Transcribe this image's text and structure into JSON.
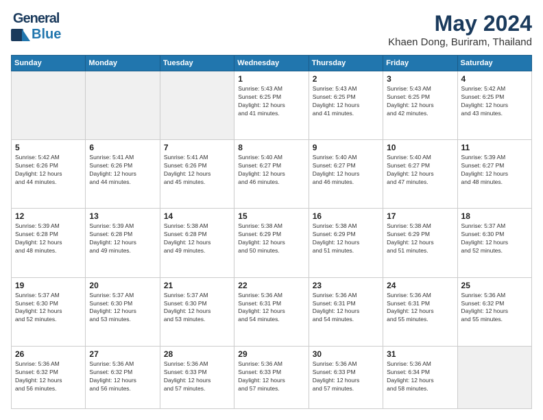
{
  "header": {
    "logo_line1": "General",
    "logo_line2": "Blue",
    "title": "May 2024",
    "subtitle": "Khaen Dong, Buriram, Thailand"
  },
  "weekdays": [
    "Sunday",
    "Monday",
    "Tuesday",
    "Wednesday",
    "Thursday",
    "Friday",
    "Saturday"
  ],
  "weeks": [
    [
      {
        "day": "",
        "info": ""
      },
      {
        "day": "",
        "info": ""
      },
      {
        "day": "",
        "info": ""
      },
      {
        "day": "1",
        "info": "Sunrise: 5:43 AM\nSunset: 6:25 PM\nDaylight: 12 hours\nand 41 minutes."
      },
      {
        "day": "2",
        "info": "Sunrise: 5:43 AM\nSunset: 6:25 PM\nDaylight: 12 hours\nand 41 minutes."
      },
      {
        "day": "3",
        "info": "Sunrise: 5:43 AM\nSunset: 6:25 PM\nDaylight: 12 hours\nand 42 minutes."
      },
      {
        "day": "4",
        "info": "Sunrise: 5:42 AM\nSunset: 6:25 PM\nDaylight: 12 hours\nand 43 minutes."
      }
    ],
    [
      {
        "day": "5",
        "info": "Sunrise: 5:42 AM\nSunset: 6:26 PM\nDaylight: 12 hours\nand 44 minutes."
      },
      {
        "day": "6",
        "info": "Sunrise: 5:41 AM\nSunset: 6:26 PM\nDaylight: 12 hours\nand 44 minutes."
      },
      {
        "day": "7",
        "info": "Sunrise: 5:41 AM\nSunset: 6:26 PM\nDaylight: 12 hours\nand 45 minutes."
      },
      {
        "day": "8",
        "info": "Sunrise: 5:40 AM\nSunset: 6:27 PM\nDaylight: 12 hours\nand 46 minutes."
      },
      {
        "day": "9",
        "info": "Sunrise: 5:40 AM\nSunset: 6:27 PM\nDaylight: 12 hours\nand 46 minutes."
      },
      {
        "day": "10",
        "info": "Sunrise: 5:40 AM\nSunset: 6:27 PM\nDaylight: 12 hours\nand 47 minutes."
      },
      {
        "day": "11",
        "info": "Sunrise: 5:39 AM\nSunset: 6:27 PM\nDaylight: 12 hours\nand 48 minutes."
      }
    ],
    [
      {
        "day": "12",
        "info": "Sunrise: 5:39 AM\nSunset: 6:28 PM\nDaylight: 12 hours\nand 48 minutes."
      },
      {
        "day": "13",
        "info": "Sunrise: 5:39 AM\nSunset: 6:28 PM\nDaylight: 12 hours\nand 49 minutes."
      },
      {
        "day": "14",
        "info": "Sunrise: 5:38 AM\nSunset: 6:28 PM\nDaylight: 12 hours\nand 49 minutes."
      },
      {
        "day": "15",
        "info": "Sunrise: 5:38 AM\nSunset: 6:29 PM\nDaylight: 12 hours\nand 50 minutes."
      },
      {
        "day": "16",
        "info": "Sunrise: 5:38 AM\nSunset: 6:29 PM\nDaylight: 12 hours\nand 51 minutes."
      },
      {
        "day": "17",
        "info": "Sunrise: 5:38 AM\nSunset: 6:29 PM\nDaylight: 12 hours\nand 51 minutes."
      },
      {
        "day": "18",
        "info": "Sunrise: 5:37 AM\nSunset: 6:30 PM\nDaylight: 12 hours\nand 52 minutes."
      }
    ],
    [
      {
        "day": "19",
        "info": "Sunrise: 5:37 AM\nSunset: 6:30 PM\nDaylight: 12 hours\nand 52 minutes."
      },
      {
        "day": "20",
        "info": "Sunrise: 5:37 AM\nSunset: 6:30 PM\nDaylight: 12 hours\nand 53 minutes."
      },
      {
        "day": "21",
        "info": "Sunrise: 5:37 AM\nSunset: 6:30 PM\nDaylight: 12 hours\nand 53 minutes."
      },
      {
        "day": "22",
        "info": "Sunrise: 5:36 AM\nSunset: 6:31 PM\nDaylight: 12 hours\nand 54 minutes."
      },
      {
        "day": "23",
        "info": "Sunrise: 5:36 AM\nSunset: 6:31 PM\nDaylight: 12 hours\nand 54 minutes."
      },
      {
        "day": "24",
        "info": "Sunrise: 5:36 AM\nSunset: 6:31 PM\nDaylight: 12 hours\nand 55 minutes."
      },
      {
        "day": "25",
        "info": "Sunrise: 5:36 AM\nSunset: 6:32 PM\nDaylight: 12 hours\nand 55 minutes."
      }
    ],
    [
      {
        "day": "26",
        "info": "Sunrise: 5:36 AM\nSunset: 6:32 PM\nDaylight: 12 hours\nand 56 minutes."
      },
      {
        "day": "27",
        "info": "Sunrise: 5:36 AM\nSunset: 6:32 PM\nDaylight: 12 hours\nand 56 minutes."
      },
      {
        "day": "28",
        "info": "Sunrise: 5:36 AM\nSunset: 6:33 PM\nDaylight: 12 hours\nand 57 minutes."
      },
      {
        "day": "29",
        "info": "Sunrise: 5:36 AM\nSunset: 6:33 PM\nDaylight: 12 hours\nand 57 minutes."
      },
      {
        "day": "30",
        "info": "Sunrise: 5:36 AM\nSunset: 6:33 PM\nDaylight: 12 hours\nand 57 minutes."
      },
      {
        "day": "31",
        "info": "Sunrise: 5:36 AM\nSunset: 6:34 PM\nDaylight: 12 hours\nand 58 minutes."
      },
      {
        "day": "",
        "info": ""
      }
    ]
  ]
}
